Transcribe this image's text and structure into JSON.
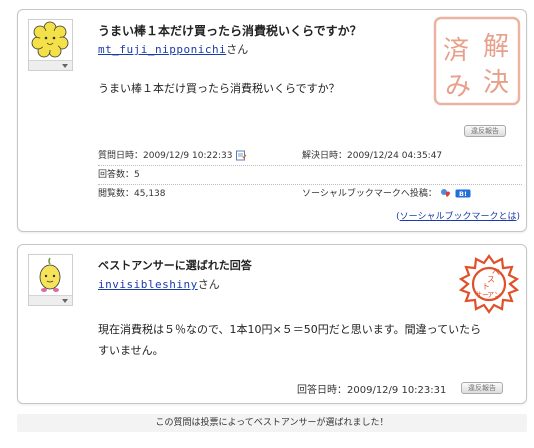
{
  "question": {
    "title": "うまい棒１本だけ買ったら消費税いくらですか？",
    "user": "mt_fuji_nipponichi",
    "user_suffix": "さん",
    "body": "うまい棒１本だけ買ったら消費税いくらですか？",
    "report_label": "違反報告",
    "stamp_label": "解決済み",
    "stamp_chars": [
      "解",
      "済",
      "決",
      "み"
    ],
    "asked_label": "質問日時：2009/12/9 10:22:33",
    "resolved_label": "解決日時：2009/12/24 04:35:47",
    "answers_label": "回答数：5",
    "views_label": "閲覧数：45,138",
    "social_label": "ソーシャルブックマークへ投稿：",
    "social_link_prefix": "(",
    "social_link": "ソーシャルブックマークとは",
    "social_link_suffix": ")",
    "hatena_badge": "B!"
  },
  "best_answer": {
    "title": "ベストアンサーに選ばれた回答",
    "user": "invisibleshiny",
    "user_suffix": "さん",
    "body_line1": "現在消費税は５％なので、1本10円×５＝50円だと思います。間違っていたら",
    "body_line2": "すいません。",
    "answered_label": "回答日時：2009/12/9 10:23:31",
    "report_label": "違反報告",
    "stamp_chars": [
      "ベ",
      "ス",
      "ト",
      "アン",
      "サー"
    ]
  },
  "footer": {
    "message": "この質問は投票によってベストアンサーが選ばれました！"
  },
  "colors": {
    "link": "#1a3caa",
    "stamp_solved": "#e8a08a",
    "stamp_best": "#e0502a",
    "card_border": "#c6c6c6"
  },
  "icons": {
    "question_avatar": "yellow-flower-character-icon",
    "answer_avatar": "yellow-onion-character-icon",
    "asked_icon": "notepad-icon",
    "social_icon_1": "bookmark-heart-icon",
    "social_icon_2": "hatena-bookmark-icon"
  }
}
